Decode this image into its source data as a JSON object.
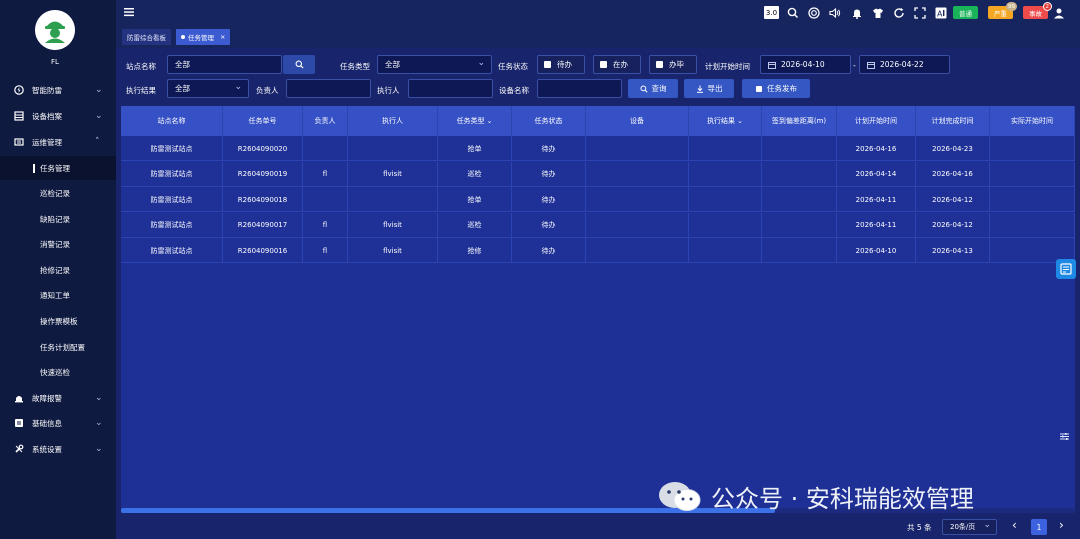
{
  "sidebar": {
    "user": "FL",
    "items": [
      {
        "label": "智能防雷",
        "icon": "shield-icon"
      },
      {
        "label": "设备档案",
        "icon": "archive-icon"
      },
      {
        "label": "运维管理",
        "icon": "maintenance-icon"
      },
      {
        "label": "故障报警",
        "icon": "alarm-icon"
      },
      {
        "label": "基础信息",
        "icon": "info-icon"
      },
      {
        "label": "系统设置",
        "icon": "settings-icon"
      }
    ],
    "sub_items": [
      "任务管理",
      "巡检记录",
      "缺陷记录",
      "消警记录",
      "抢修记录",
      "通知工单",
      "操作票模板",
      "任务计划配置",
      "快速巡检"
    ]
  },
  "topbar": {
    "version": "3.0",
    "badges": [
      {
        "label": "普通",
        "color": "#19b45a"
      },
      {
        "label": "严重",
        "color": "#f5a623",
        "count": "99"
      },
      {
        "label": "事故",
        "color": "#ef4b4b",
        "count": "2"
      }
    ]
  },
  "tabs": [
    {
      "label": "防雷综合看板",
      "active": false
    },
    {
      "label": "任务管理",
      "active": true,
      "close": "×"
    }
  ],
  "filters": {
    "site_name_label": "站点名称",
    "site_name_value": "全部",
    "task_type_label": "任务类型",
    "task_type_value": "全部",
    "task_status_label": "任务状态",
    "status_options": [
      "待办",
      "在办",
      "办毕"
    ],
    "plan_start_label": "计划开始时间",
    "start_date": "2026-04-10",
    "date_sep": "-",
    "end_date": "2026-04-22",
    "exec_result_label": "执行结果",
    "exec_result_value": "全部",
    "owner_label": "负责人",
    "executor_label": "执行人",
    "device_name_label": "设备名称",
    "query_button": "查询",
    "export_button": "导出",
    "publish_button": "任务发布"
  },
  "table": {
    "columns": [
      "站点名称",
      "任务单号",
      "负责人",
      "执行人",
      "任务类型",
      "任务状态",
      "设备",
      "执行结果",
      "签到偏差距离(m)",
      "计划开始时间",
      "计划完成时间",
      "实际开始时间"
    ],
    "rows": [
      [
        "防雷测试站点",
        "R2604090020",
        "",
        "",
        "抢单",
        "待办",
        "",
        "",
        "",
        "2026-04-16",
        "2026-04-23",
        ""
      ],
      [
        "防雷测试站点",
        "R2604090019",
        "fl",
        "flvisit",
        "巡检",
        "待办",
        "",
        "",
        "",
        "2026-04-14",
        "2026-04-16",
        ""
      ],
      [
        "防雷测试站点",
        "R2604090018",
        "",
        "",
        "抢单",
        "待办",
        "",
        "",
        "",
        "2026-04-11",
        "2026-04-12",
        ""
      ],
      [
        "防雷测试站点",
        "R2604090017",
        "fl",
        "flvisit",
        "巡检",
        "待办",
        "",
        "",
        "",
        "2026-04-11",
        "2026-04-12",
        ""
      ],
      [
        "防雷测试站点",
        "R2604090016",
        "fl",
        "flvisit",
        "抢修",
        "待办",
        "",
        "",
        "",
        "2026-04-10",
        "2026-04-13",
        ""
      ]
    ]
  },
  "pager": {
    "total": "共 5 条",
    "page_size": "20条/页",
    "current_page": "1",
    "prev": "‹",
    "next": "›"
  },
  "watermark": "公众号 · 安科瑞能效管理"
}
